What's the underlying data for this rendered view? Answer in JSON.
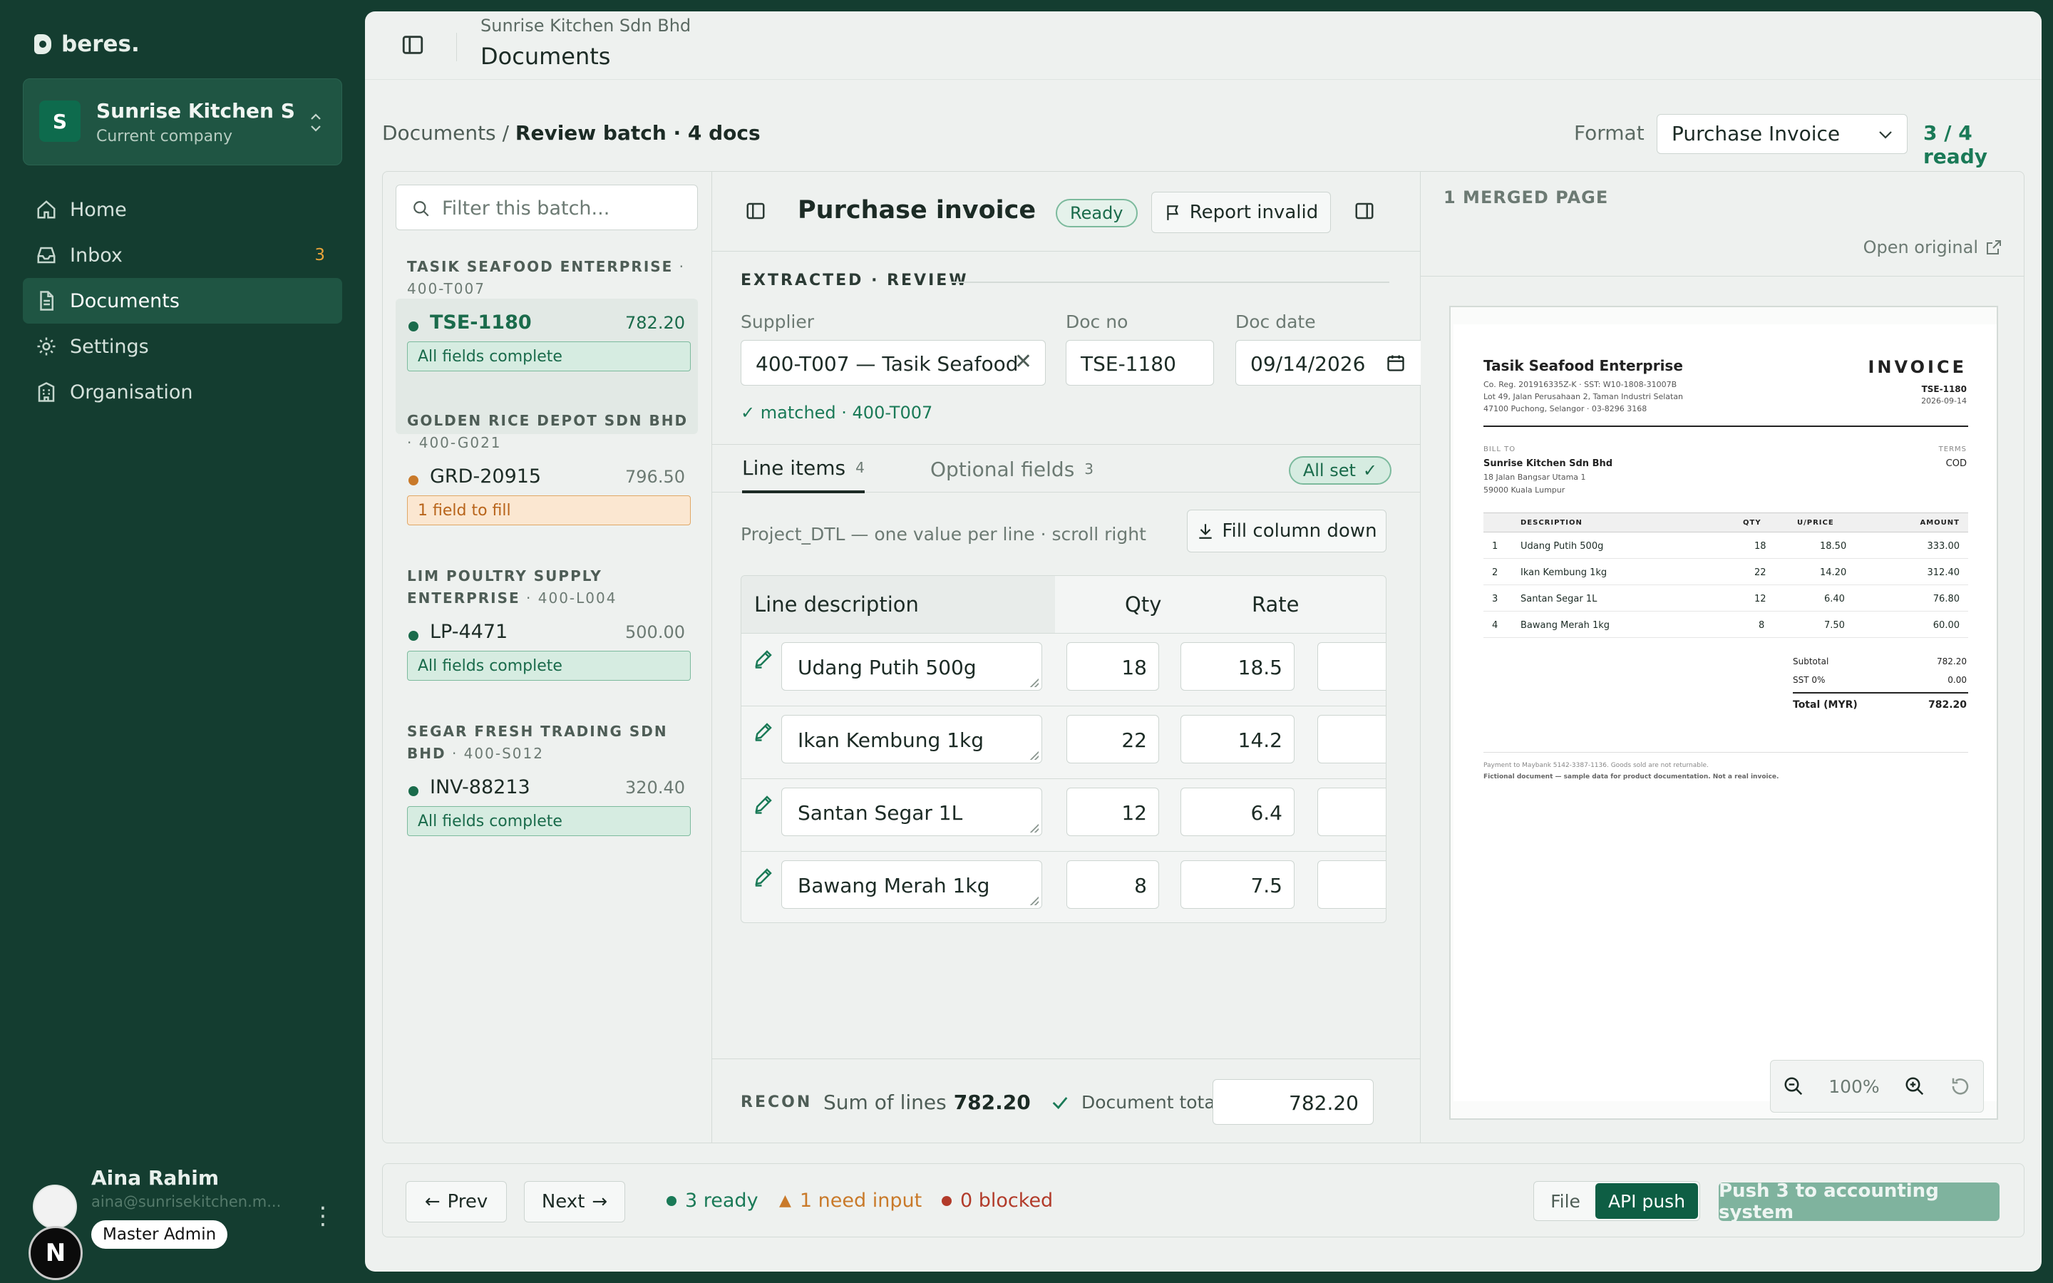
{
  "brand": {
    "name": "beres."
  },
  "company": {
    "avatar": "S",
    "name": "Sunrise Kitchen Sd...",
    "sub": "Current company"
  },
  "nav": [
    {
      "label": "Home",
      "icon": "home-icon"
    },
    {
      "label": "Inbox",
      "icon": "inbox-icon",
      "badge": "3"
    },
    {
      "label": "Documents",
      "icon": "document-icon"
    },
    {
      "label": "Settings",
      "icon": "gear-icon"
    },
    {
      "label": "Organisation",
      "icon": "building-icon"
    }
  ],
  "user": {
    "name": "Aina Rahim",
    "email": "aina@sunrisekitchen.m...",
    "initial": "N",
    "role": "Master Admin"
  },
  "topbar": {
    "company": "Sunrise Kitchen Sdn Bhd",
    "title": "Documents"
  },
  "breadcrumb": {
    "root": "Documents",
    "sep": "/",
    "current": "Review batch · 4 docs"
  },
  "format": {
    "label": "Format",
    "value": "Purchase Invoice"
  },
  "ready_count": "3 / 4 ready",
  "batch": {
    "filter_placeholder": "Filter this batch...",
    "groups": [
      {
        "supplier": "TASIK SEAFOOD ENTERPRISE",
        "code": "400-T007",
        "doc_id": "TSE-1180",
        "amount": "782.20",
        "status": "All fields complete",
        "state": "ok"
      },
      {
        "supplier": "GOLDEN RICE DEPOT SDN BHD",
        "code": "400-G021",
        "doc_id": "GRD-20915",
        "amount": "796.50",
        "status": "1 field to fill",
        "state": "warn"
      },
      {
        "supplier": "LIM POULTRY SUPPLY ENTERPRISE",
        "code": "400-L004",
        "doc_id": "LP-4471",
        "amount": "500.00",
        "status": "All fields complete",
        "state": "ok"
      },
      {
        "supplier": "SEGAR FRESH TRADING SDN BHD",
        "code": "400-S012",
        "doc_id": "INV-88213",
        "amount": "320.40",
        "status": "All fields complete",
        "state": "ok"
      }
    ]
  },
  "review": {
    "title": "Purchase invoice · ...",
    "status": "Ready",
    "report_label": "Report invalid",
    "section": "EXTRACTED · REVIEW",
    "supplier_label": "Supplier",
    "supplier_value": "400-T007 — Tasik Seafood",
    "docno_label": "Doc no",
    "docno_value": "TSE-1180",
    "docdate_label": "Doc date",
    "docdate_value": "09/14/2026",
    "matched": "matched · 400-T007",
    "tabs": [
      {
        "label": "Line items",
        "count": "4"
      },
      {
        "label": "Optional fields",
        "count": "3"
      }
    ],
    "allset": "All set",
    "project_note": "Project_DTL — one value per line · scroll right",
    "fill_label": "Fill column down",
    "columns": {
      "desc": "Line description",
      "qty": "Qty",
      "rate": "Rate"
    },
    "lines": [
      {
        "desc": "Udang Putih 500g",
        "qty": "18",
        "rate": "18.5"
      },
      {
        "desc": "Ikan Kembung 1kg",
        "qty": "22",
        "rate": "14.2"
      },
      {
        "desc": "Santan Segar 1L",
        "qty": "12",
        "rate": "6.4"
      },
      {
        "desc": "Bawang Merah 1kg",
        "qty": "8",
        "rate": "7.5"
      }
    ],
    "recon": {
      "label": "RECON",
      "sum_label": "Sum of lines",
      "sum_value": "782.20",
      "doc_total_label": "Document total",
      "doc_total_value": "782.20"
    }
  },
  "preview": {
    "merged": "1 MERGED PAGE",
    "open_original": "Open original",
    "zoom": "100%",
    "invoice": {
      "seller": "Tasik Seafood Enterprise",
      "reg": "Co. Reg. 201916335Z-K · SST: W10-1808-31007B",
      "addr1": "Lot 49, Jalan Perusahaan 2, Taman Industri Selatan",
      "addr2": "47100 Puchong, Selangor · 03-8296 3168",
      "heading": "INVOICE",
      "number": "TSE-1180",
      "date": "2026-09-14",
      "bill_to_label": "BILL TO",
      "bill_to_name": "Sunrise Kitchen Sdn Bhd",
      "bill_to_addr1": "18 Jalan Bangsar Utama 1",
      "bill_to_addr2": "59000 Kuala Lumpur",
      "terms_label": "TERMS",
      "terms_value": "COD",
      "col_desc": "DESCRIPTION",
      "col_qty": "QTY",
      "col_price": "U/PRICE",
      "col_amount": "AMOUNT",
      "rows": [
        {
          "n": "1",
          "desc": "Udang Putih 500g",
          "qty": "18",
          "price": "18.50",
          "amount": "333.00"
        },
        {
          "n": "2",
          "desc": "Ikan Kembung 1kg",
          "qty": "22",
          "price": "14.20",
          "amount": "312.40"
        },
        {
          "n": "3",
          "desc": "Santan Segar 1L",
          "qty": "12",
          "price": "6.40",
          "amount": "76.80"
        },
        {
          "n": "4",
          "desc": "Bawang Merah 1kg",
          "qty": "8",
          "price": "7.50",
          "amount": "60.00"
        }
      ],
      "subtotal_label": "Subtotal",
      "subtotal": "782.20",
      "sst_label": "SST 0%",
      "sst": "0.00",
      "total_label": "Total (MYR)",
      "total": "782.20",
      "footer1": "Payment to Maybank 5142-3387-1136. Goods sold are not returnable.",
      "footer2": "Fictional document — sample data for product documentation. Not a real invoice."
    }
  },
  "bottom": {
    "prev": "Prev",
    "next": "Next",
    "ready": "3 ready",
    "need": "1 need input",
    "blocked": "0 blocked",
    "file": "File",
    "api": "API push",
    "push": "Push 3 to accounting system"
  },
  "colors": {
    "accent": "#0e5e44",
    "ok": "#1a7a57",
    "warn": "#c97a2a",
    "err": "#b23b2a",
    "sidebar": "#143d30"
  }
}
